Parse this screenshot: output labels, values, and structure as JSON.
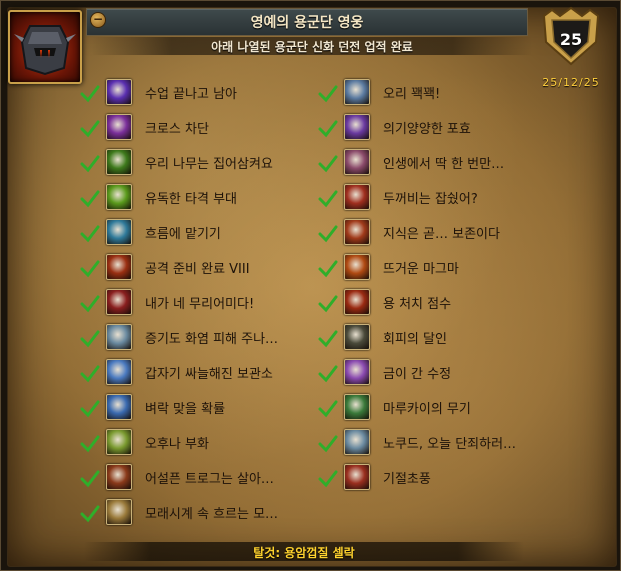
{
  "achievement": {
    "title": "영예의 용군단 영웅",
    "description": "아래 나열된 용군단 신화 던전 업적 완료",
    "points": "25",
    "date": "25/12/25",
    "reward": "탈것: 용암껍질 셀락",
    "icon": "helmet-icon"
  },
  "colors": {
    "check": "#2fae2a",
    "date": "#ffcf3d",
    "reward": "#ffd22e",
    "title_bar": "#2f383a"
  },
  "criteria_left": [
    {
      "label": "수업 끝나고 남아",
      "icon": "arcane-orb-icon",
      "color": "#5a2fb0"
    },
    {
      "label": "크로스 차단",
      "icon": "purple-beast-icon",
      "color": "#7a2f9a"
    },
    {
      "label": "우리 나무는 집어삼켜요",
      "icon": "green-spikes-icon",
      "color": "#3e7a1c"
    },
    {
      "label": "유독한 타격 부대",
      "icon": "green-claw-icon",
      "color": "#5a9a1c"
    },
    {
      "label": "흐름에 맡기기",
      "icon": "water-creature-icon",
      "color": "#2f7a9a"
    },
    {
      "label": "공격 준비 완료 VIII",
      "icon": "red-slashes-icon",
      "color": "#9a2f12"
    },
    {
      "label": "내가 네 무리어미다!",
      "icon": "red-dragon-icon",
      "color": "#8a1f1f"
    },
    {
      "label": "증기도 화염 피해 주나…",
      "icon": "steam-swirl-icon",
      "color": "#6a8aa0"
    },
    {
      "label": "갑자기 싸늘해진 보관소",
      "icon": "frost-crystal-icon",
      "color": "#4a7ac0"
    },
    {
      "label": "벼락 맞을 확률",
      "icon": "lightning-icon",
      "color": "#3a6ab0"
    },
    {
      "label": "오후나 부화",
      "icon": "green-egg-icon",
      "color": "#7a9a2f"
    },
    {
      "label": "어설픈 트로그는 살아…",
      "icon": "troggs-icon",
      "color": "#8a3a1a"
    },
    {
      "label": "모래시계 속 흐르는 모…",
      "icon": "hourglass-icon",
      "color": "#9a7a3a"
    }
  ],
  "criteria_right": [
    {
      "label": "오리 꽥꽥!",
      "icon": "duck-icon",
      "color": "#5a7aa0"
    },
    {
      "label": "의기양양한 포효",
      "icon": "roar-icon",
      "color": "#6a3aa0"
    },
    {
      "label": "인생에서 딱 한 번만…",
      "icon": "skull-icon",
      "color": "#8a4a6a"
    },
    {
      "label": "두꺼비는 잡쉈어?",
      "icon": "toad-icon",
      "color": "#a02f1f"
    },
    {
      "label": "지식은 곧… 보존이다",
      "icon": "tome-icon",
      "color": "#a03a1a"
    },
    {
      "label": "뜨거운 마그마",
      "icon": "magma-icon",
      "color": "#b04a12"
    },
    {
      "label": "용 처치 점수",
      "icon": "dragon-kill-icon",
      "color": "#9a2a12"
    },
    {
      "label": "회피의 달인",
      "icon": "dodge-icon",
      "color": "#4a4a3a"
    },
    {
      "label": "금이 간 수정",
      "icon": "cracked-crystal-icon",
      "color": "#8a4ab0"
    },
    {
      "label": "마루카이의 무기",
      "icon": "weapon-icon",
      "color": "#3a7a3a"
    },
    {
      "label": "노쿠드, 오늘 단죄하러…",
      "icon": "storm-icon",
      "color": "#6a8aa0"
    },
    {
      "label": "기절초풍",
      "icon": "stun-icon",
      "color": "#9a2f1f"
    }
  ]
}
